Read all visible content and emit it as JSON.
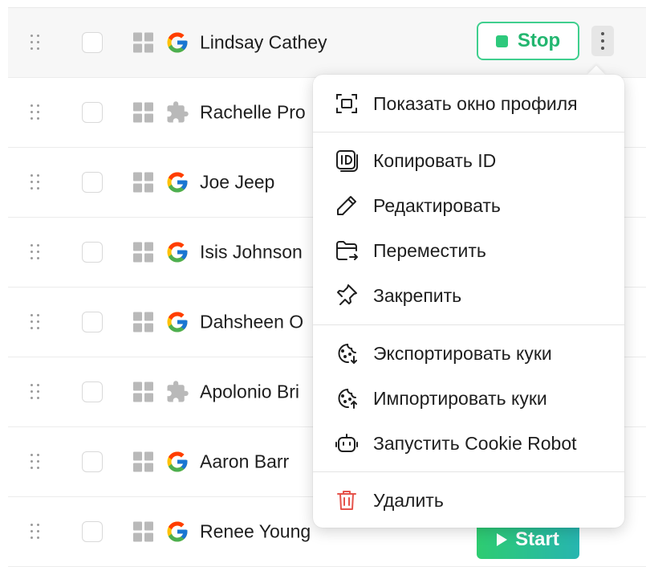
{
  "rows": [
    {
      "name": "Lindsay Cathey",
      "browser": "google-icon",
      "action": "Stop"
    },
    {
      "name": "Rachelle Pro",
      "browser": "puzzle-icon"
    },
    {
      "name": "Joe Jeep",
      "browser": "google-icon"
    },
    {
      "name": "Isis Johnson",
      "browser": "google-icon"
    },
    {
      "name": "Dahsheen O",
      "browser": "google-icon"
    },
    {
      "name": "Apolonio Bri",
      "browser": "puzzle-icon"
    },
    {
      "name": "Aaron Barr",
      "browser": "google-icon"
    },
    {
      "name": "Renee Young",
      "browser": "google-icon",
      "action": "Start"
    }
  ],
  "menu": {
    "show_profile": "Показать окно профиля",
    "copy_id": "Копировать ID",
    "edit": "Редактировать",
    "move": "Переместить",
    "pin": "Закрепить",
    "export_cookies": "Экспортировать куки",
    "import_cookies": "Импортировать куки",
    "cookie_robot": "Запустить Cookie Robot",
    "delete": "Удалить"
  },
  "colors": {
    "stop_green": "#22b66f",
    "delete_red": "#e5534b",
    "start_gradient": [
      "#2ecc71",
      "#27b5b0"
    ]
  }
}
